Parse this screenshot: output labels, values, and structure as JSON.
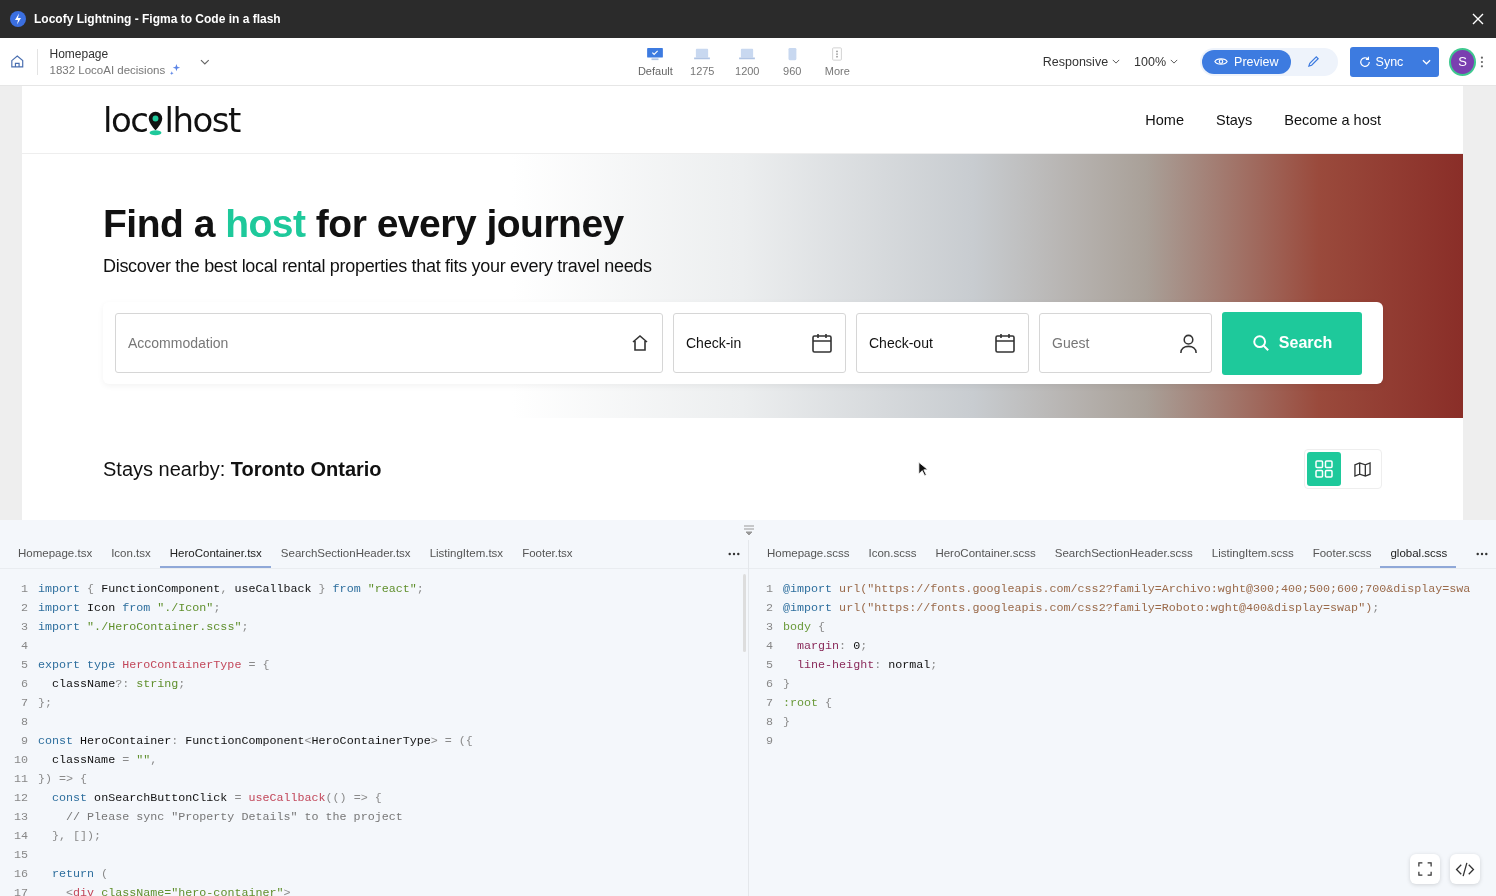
{
  "window": {
    "title": "Locofy Lightning - Figma to Code in a flash"
  },
  "toolbar": {
    "page": "Homepage",
    "decisions": "1832 LocoAI decisions",
    "devices": [
      {
        "label": "Default",
        "kind": "desktop",
        "selected": true
      },
      {
        "label": "1275",
        "kind": "laptop",
        "selected": false
      },
      {
        "label": "1200",
        "kind": "laptop",
        "selected": false
      },
      {
        "label": "960",
        "kind": "tablet",
        "selected": false
      },
      {
        "label": "More",
        "kind": "more",
        "selected": false
      }
    ],
    "mode": "Responsive",
    "zoom": "100%",
    "preview": "Preview",
    "sync": "Sync",
    "avatar": "S"
  },
  "site": {
    "logo": {
      "before": "loc",
      "after": "lhost"
    },
    "nav": [
      "Home",
      "Stays",
      "Become a host"
    ],
    "heading": [
      {
        "text": "Find a ",
        "accent": false
      },
      {
        "text": "host",
        "accent": true
      },
      {
        "text": " for every journey",
        "accent": false
      }
    ],
    "subheading": "Discover the best local rental properties that fits your every travel needs",
    "fields": [
      {
        "label": "Accommodation",
        "kind": "home",
        "placeholder": true
      },
      {
        "label": "Check-in",
        "kind": "calendar",
        "placeholder": false
      },
      {
        "label": "Check-out",
        "kind": "calendar",
        "placeholder": false
      },
      {
        "label": "Guest",
        "kind": "person",
        "placeholder": true
      }
    ],
    "search": "Search",
    "nearby": "Stays nearby: **Toronto Ontario**",
    "views": [
      {
        "kind": "grid",
        "selected": true
      },
      {
        "kind": "map",
        "selected": false
      }
    ]
  },
  "editors": [
    {
      "tabs": [
        {
          "label": "Homepage.tsx",
          "selected": false
        },
        {
          "label": "Icon.tsx",
          "selected": false
        },
        {
          "label": "HeroContainer.tsx",
          "selected": true
        },
        {
          "label": "SearchSectionHeader.tsx",
          "selected": false
        },
        {
          "label": "ListingItem.tsx",
          "selected": false
        },
        {
          "label": "Footer.tsx",
          "selected": false
        }
      ],
      "lines": [
        {
          "n": "1",
          "tokens": [
            {
              "kind": "kw",
              "text": "import"
            },
            {
              "kind": "p",
              "text": " { "
            },
            {
              "kind": "x",
              "text": "FunctionComponent"
            },
            {
              "kind": "p",
              "text": ", "
            },
            {
              "kind": "x",
              "text": "useCallback"
            },
            {
              "kind": "p",
              "text": " } "
            },
            {
              "kind": "kw",
              "text": "from"
            },
            {
              "kind": "s",
              "text": " \"react\""
            },
            {
              "kind": "p",
              "text": ";"
            }
          ]
        },
        {
          "n": "2",
          "tokens": [
            {
              "kind": "kw",
              "text": "import"
            },
            {
              "kind": "x",
              "text": " Icon "
            },
            {
              "kind": "kw",
              "text": "from"
            },
            {
              "kind": "s",
              "text": " \"./Icon\""
            },
            {
              "kind": "p",
              "text": ";"
            }
          ]
        },
        {
          "n": "3",
          "tokens": [
            {
              "kind": "kw",
              "text": "import"
            },
            {
              "kind": "s",
              "text": " \"./HeroContainer.scss\""
            },
            {
              "kind": "p",
              "text": ";"
            }
          ]
        },
        {
          "n": "4"
        },
        {
          "n": "5",
          "tokens": [
            {
              "kind": "kw",
              "text": "export type"
            },
            {
              "kind": "t",
              "text": " HeroContainerType"
            },
            {
              "kind": "p",
              "text": " = {"
            }
          ]
        },
        {
          "n": "6",
          "tokens": [
            {
              "kind": "x",
              "text": "  className"
            },
            {
              "kind": "p",
              "text": "?: "
            },
            {
              "kind": "s",
              "text": "string"
            },
            {
              "kind": "p",
              "text": ";"
            }
          ]
        },
        {
          "n": "7",
          "tokens": [
            {
              "kind": "p",
              "text": "};"
            }
          ]
        },
        {
          "n": "8"
        },
        {
          "n": "9",
          "tokens": [
            {
              "kind": "kw",
              "text": "const"
            },
            {
              "kind": "x",
              "text": " HeroContainer"
            },
            {
              "kind": "p",
              "text": ": "
            },
            {
              "kind": "x",
              "text": "FunctionComponent"
            },
            {
              "kind": "p",
              "text": "<"
            },
            {
              "kind": "x",
              "text": "HeroContainerType"
            },
            {
              "kind": "p",
              "text": "> = ({"
            }
          ]
        },
        {
          "n": "10",
          "tokens": [
            {
              "kind": "x",
              "text": "  className"
            },
            {
              "kind": "p",
              "text": " = "
            },
            {
              "kind": "s",
              "text": "\"\""
            },
            {
              "kind": "p",
              "text": ","
            }
          ]
        },
        {
          "n": "11",
          "tokens": [
            {
              "kind": "p",
              "text": "}) => {"
            }
          ]
        },
        {
          "n": "12",
          "tokens": [
            {
              "kind": "kw",
              "text": "  const"
            },
            {
              "kind": "x",
              "text": " onSearchButtonClick"
            },
            {
              "kind": "p",
              "text": " = "
            },
            {
              "kind": "t",
              "text": "useCallback"
            },
            {
              "kind": "p",
              "text": "(() => {"
            }
          ]
        },
        {
          "n": "13",
          "tokens": [
            {
              "kind": "c",
              "text": "    // Please sync \"Property Details\" to the project"
            }
          ]
        },
        {
          "n": "14",
          "tokens": [
            {
              "kind": "p",
              "text": "  }, []);"
            }
          ]
        },
        {
          "n": "15"
        },
        {
          "n": "16",
          "tokens": [
            {
              "kind": "kw",
              "text": "  return"
            },
            {
              "kind": "p",
              "text": " ("
            }
          ]
        },
        {
          "n": "17",
          "tokens": [
            {
              "kind": "p",
              "text": "    <"
            },
            {
              "kind": "t",
              "text": "div"
            },
            {
              "kind": "s",
              "text": " className="
            },
            {
              "kind": "s",
              "text": "\"hero-container\""
            },
            {
              "kind": "p",
              "text": ">"
            }
          ]
        }
      ]
    },
    {
      "tabs": [
        {
          "label": "Homepage.scss",
          "selected": false
        },
        {
          "label": "Icon.scss",
          "selected": false
        },
        {
          "label": "HeroContainer.scss",
          "selected": false
        },
        {
          "label": "SearchSectionHeader.scss",
          "selected": false
        },
        {
          "label": "ListingItem.scss",
          "selected": false
        },
        {
          "label": "Footer.scss",
          "selected": false
        },
        {
          "label": "global.scss",
          "selected": true
        }
      ],
      "lines": [
        {
          "n": "1",
          "tokens": [
            {
              "kind": "kw",
              "text": "@import"
            },
            {
              "kind": "u",
              "text": " url(\"https://fonts.googleapis.com/css2?family=Archivo:wght@300;400;500;600;700&display=swa"
            }
          ]
        },
        {
          "n": "2",
          "tokens": [
            {
              "kind": "kw",
              "text": "@import"
            },
            {
              "kind": "u",
              "text": " url(\"https://fonts.googleapis.com/css2?family=Roboto:wght@400&display=swap\")"
            },
            {
              "kind": "p",
              "text": ";"
            }
          ]
        },
        {
          "n": "3",
          "tokens": [
            {
              "kind": "g",
              "text": "body"
            },
            {
              "kind": "p",
              "text": " {"
            }
          ]
        },
        {
          "n": "4",
          "tokens": [
            {
              "kind": "m",
              "text": "  margin"
            },
            {
              "kind": "p",
              "text": ": "
            },
            {
              "kind": "x",
              "text": "0"
            },
            {
              "kind": "p",
              "text": ";"
            }
          ]
        },
        {
          "n": "5",
          "tokens": [
            {
              "kind": "m",
              "text": "  line-height"
            },
            {
              "kind": "p",
              "text": ": "
            },
            {
              "kind": "x",
              "text": "normal"
            },
            {
              "kind": "p",
              "text": ";"
            }
          ]
        },
        {
          "n": "6",
          "tokens": [
            {
              "kind": "p",
              "text": "}"
            }
          ]
        },
        {
          "n": "7",
          "tokens": [
            {
              "kind": "g",
              "text": ":root"
            },
            {
              "kind": "p",
              "text": " {"
            }
          ]
        },
        {
          "n": "8",
          "tokens": [
            {
              "kind": "p",
              "text": "}"
            }
          ]
        },
        {
          "n": "9"
        }
      ]
    }
  ]
}
